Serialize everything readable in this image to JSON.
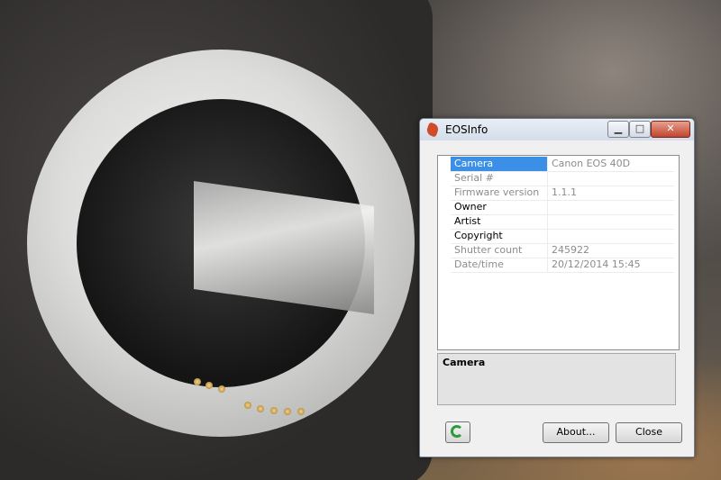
{
  "window": {
    "title": "EOSInfo",
    "controls": {
      "minimize": "",
      "maximize": "",
      "close": "✕"
    }
  },
  "properties": [
    {
      "name": "Camera",
      "value": "Canon EOS 40D",
      "selected": true,
      "readonly": false,
      "blurred": false
    },
    {
      "name": "Serial #",
      "value": "",
      "selected": false,
      "readonly": true,
      "blurred": true
    },
    {
      "name": "Firmware version",
      "value": "1.1.1",
      "selected": false,
      "readonly": true,
      "blurred": false
    },
    {
      "name": "Owner",
      "value": "",
      "selected": false,
      "readonly": false,
      "blurred": true
    },
    {
      "name": "Artist",
      "value": "",
      "selected": false,
      "readonly": false,
      "blurred": false
    },
    {
      "name": "Copyright",
      "value": "",
      "selected": false,
      "readonly": false,
      "blurred": false
    },
    {
      "name": "Shutter count",
      "value": "245922",
      "selected": false,
      "readonly": true,
      "blurred": false
    },
    {
      "name": "Date/time",
      "value": "20/12/2014 15:45",
      "selected": false,
      "readonly": true,
      "blurred": false
    }
  ],
  "description": {
    "title": "Camera"
  },
  "buttons": {
    "refresh_icon": "refresh-icon",
    "about": "About...",
    "close": "Close"
  },
  "colors": {
    "selection": "#3b8fe6",
    "refresh": "#2f9a3c",
    "app_icon": "#d14a2a"
  }
}
